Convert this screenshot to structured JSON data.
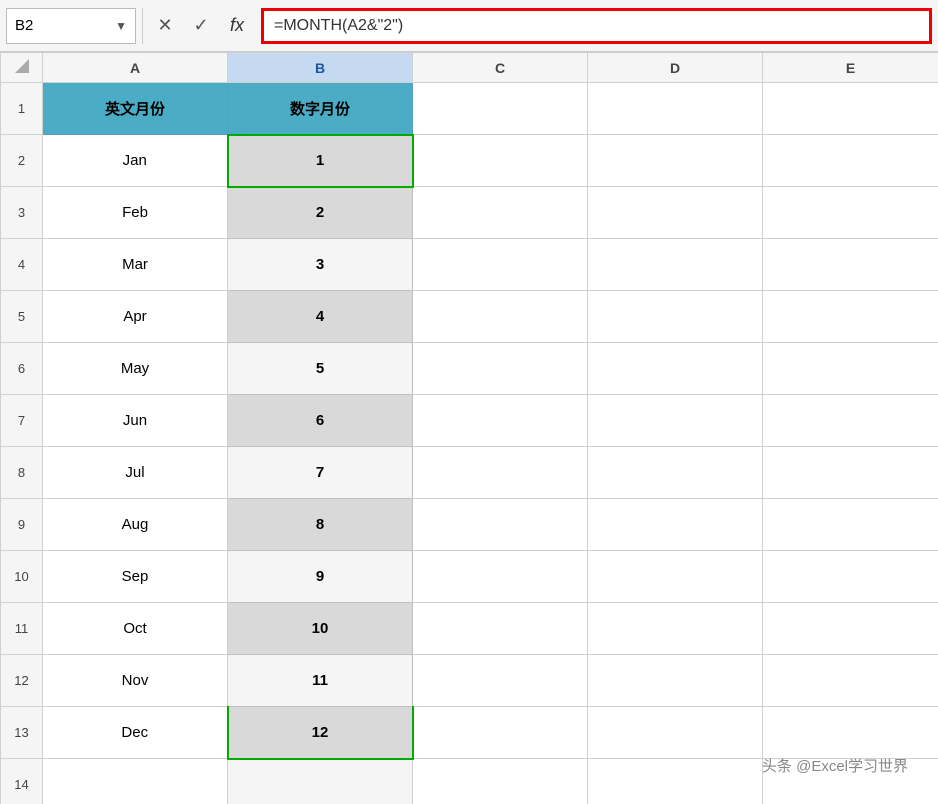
{
  "formulaBar": {
    "cellRef": "B2",
    "dropdownArrow": "▼",
    "cancelBtn": "✕",
    "confirmBtn": "✓",
    "fxLabel": "fx",
    "formula": "=MONTH(A2&\"2\")"
  },
  "columns": [
    {
      "label": "",
      "id": "row-num"
    },
    {
      "label": "A",
      "id": "col-a"
    },
    {
      "label": "B",
      "id": "col-b",
      "selected": true
    },
    {
      "label": "C",
      "id": "col-c"
    },
    {
      "label": "D",
      "id": "col-d"
    },
    {
      "label": "E",
      "id": "col-e"
    }
  ],
  "rows": [
    {
      "num": 1,
      "a": "英文月份",
      "b": "数字月份",
      "aStyle": "header",
      "bStyle": "header"
    },
    {
      "num": 2,
      "a": "Jan",
      "b": "1",
      "aStyle": "white",
      "bStyle": "active"
    },
    {
      "num": 3,
      "a": "Feb",
      "b": "2",
      "aStyle": "white",
      "bStyle": "gray"
    },
    {
      "num": 4,
      "a": "Mar",
      "b": "3",
      "aStyle": "white",
      "bStyle": "white"
    },
    {
      "num": 5,
      "a": "Apr",
      "b": "4",
      "aStyle": "white",
      "bStyle": "gray"
    },
    {
      "num": 6,
      "a": "May",
      "b": "5",
      "aStyle": "white",
      "bStyle": "white"
    },
    {
      "num": 7,
      "a": "Jun",
      "b": "6",
      "aStyle": "white",
      "bStyle": "gray"
    },
    {
      "num": 8,
      "a": "Jul",
      "b": "7",
      "aStyle": "white",
      "bStyle": "white"
    },
    {
      "num": 9,
      "a": "Aug",
      "b": "8",
      "aStyle": "white",
      "bStyle": "gray"
    },
    {
      "num": 10,
      "a": "Sep",
      "b": "9",
      "aStyle": "white",
      "bStyle": "white"
    },
    {
      "num": 11,
      "a": "Oct",
      "b": "10",
      "aStyle": "white",
      "bStyle": "gray"
    },
    {
      "num": 12,
      "a": "Nov",
      "b": "11",
      "aStyle": "white",
      "bStyle": "white"
    },
    {
      "num": 13,
      "a": "Dec",
      "b": "12",
      "aStyle": "white",
      "bStyle": "gray-green"
    },
    {
      "num": 14,
      "a": "",
      "b": "",
      "aStyle": "empty",
      "bStyle": "empty"
    }
  ],
  "watermark": "头条 @Excel学习世界"
}
